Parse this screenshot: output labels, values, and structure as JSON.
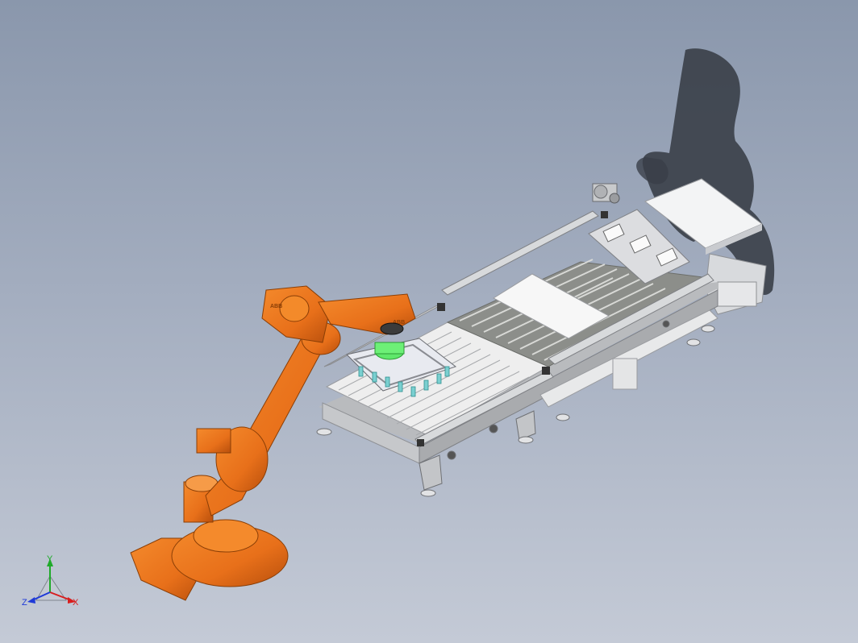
{
  "robot": {
    "brand_upper_arm": "ABB",
    "brand_wrist": "ABB",
    "color": "#e8701a"
  },
  "triad": {
    "x_label": "X",
    "y_label": "Y",
    "z_label": "Z",
    "x_color": "#d81e1e",
    "y_color": "#1faa2a",
    "z_color": "#1e3ad8"
  },
  "colors": {
    "background_top": "#8a97ac",
    "background_bottom": "#c4cad6",
    "gripper_green": "#5fe86a",
    "conveyor_frame": "#d2d4d6"
  }
}
